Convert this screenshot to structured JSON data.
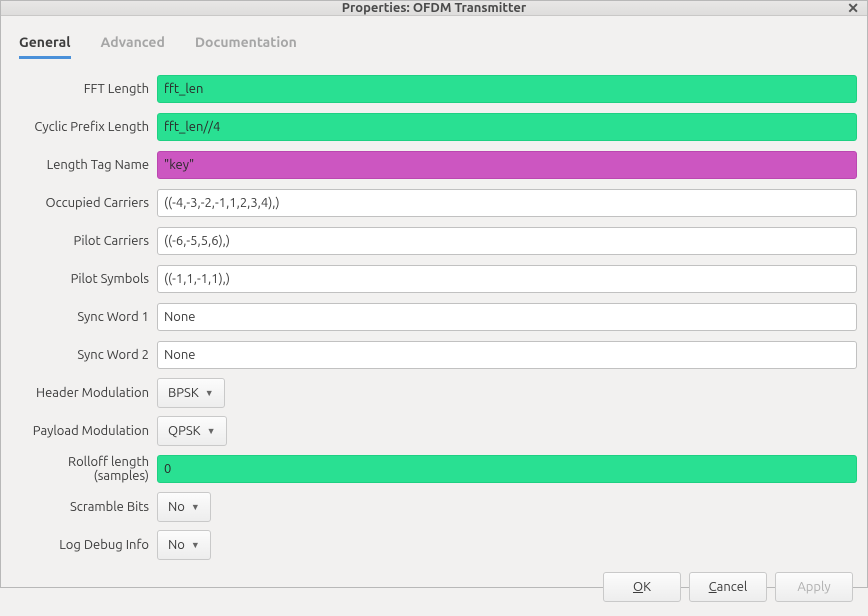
{
  "window": {
    "title": "Properties: OFDM Transmitter"
  },
  "tabs": {
    "general": "General",
    "advanced": "Advanced",
    "documentation": "Documentation"
  },
  "fields": {
    "fft_length": {
      "label": "FFT Length",
      "value": "fft_len"
    },
    "cp_length": {
      "label": "Cyclic Prefix Length",
      "value": "fft_len//4"
    },
    "length_tag_name": {
      "label": "Length Tag Name",
      "value": "\"key\""
    },
    "occupied_carriers": {
      "label": "Occupied Carriers",
      "value": "((-4,-3,-2,-1,1,2,3,4),)"
    },
    "pilot_carriers": {
      "label": "Pilot Carriers",
      "value": "((-6,-5,5,6),)"
    },
    "pilot_symbols": {
      "label": "Pilot Symbols",
      "value": "((-1,1,-1,1),)"
    },
    "sync_word_1": {
      "label": "Sync Word 1",
      "value": "None"
    },
    "sync_word_2": {
      "label": "Sync Word 2",
      "value": "None"
    },
    "header_modulation": {
      "label": "Header Modulation",
      "value": "BPSK"
    },
    "payload_modulation": {
      "label": "Payload Modulation",
      "value": "QPSK"
    },
    "rolloff_length": {
      "label": "Rolloff length (samples)",
      "value": "0"
    },
    "scramble_bits": {
      "label": "Scramble Bits",
      "value": "No"
    },
    "log_debug_info": {
      "label": "Log Debug Info",
      "value": "No"
    }
  },
  "buttons": {
    "ok_prefix": "O",
    "ok_rest": "K",
    "cancel_prefix": "C",
    "cancel_rest": "ancel",
    "apply": "Apply"
  }
}
